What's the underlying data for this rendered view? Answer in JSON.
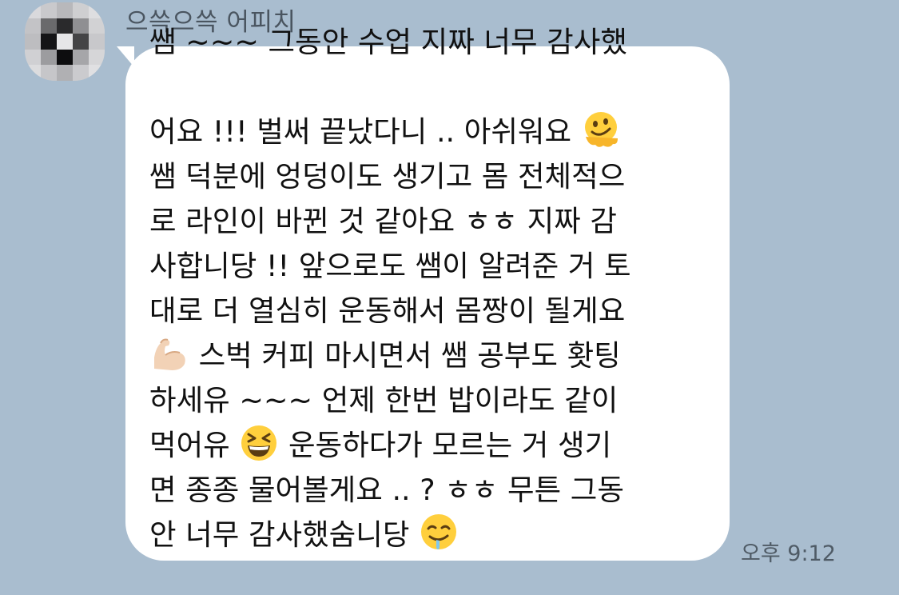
{
  "chat": {
    "sender_name": "으쓱으쓱 어피치",
    "timestamp": "오후 9:12",
    "avatar_icon": "pixelated-avatar",
    "background_color": "#a9bdcf",
    "bubble_color": "#ffffff"
  },
  "message": {
    "lines": [
      {
        "text": "쌤 ~~~ 그동안 수업 지짜 너무 감사했"
      },
      {
        "text": "어요 !!! 벌써 끝났다니 .. 아쉬워요",
        "emoji": "melting-face-emoji"
      },
      {
        "text": "쌤 덕분에 엉덩이도 생기고 몸 전체적으"
      },
      {
        "text": "로 라인이 바뀐 것 같아요 ㅎㅎ 지짜 감"
      },
      {
        "text": "사합니당 !! 앞으로도 쌤이 알려준 거 토"
      },
      {
        "text": "대로 더 열심히 운동해서 몸짱이 될게요"
      },
      {
        "text": " 스벅 커피 마시면서 쌤 공부도 홧팅",
        "emoji_before": "flexed-biceps-emoji"
      },
      {
        "text": "하세유 ~~~ 언제 한번 밥이라도 같이"
      },
      {
        "text": "먹어유",
        "emoji": "grinning-squinting-face-emoji",
        "text_after": "운동하다가 모르는 거 생기"
      },
      {
        "text": "면 종종 물어볼게요 .. ? ㅎㅎ 무튼 그동"
      },
      {
        "text": "안 너무 감사했숨니당",
        "emoji": "drooling-face-emoji"
      }
    ]
  }
}
